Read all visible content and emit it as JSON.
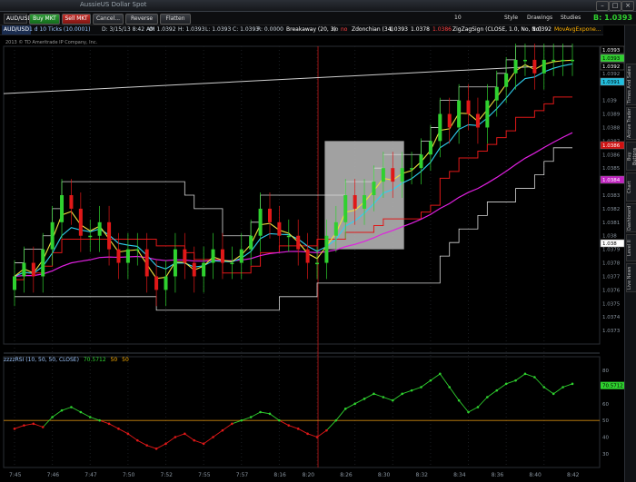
{
  "titlebar": {
    "title": "AussieUS Dollar Spot"
  },
  "toolbar": {
    "symbol": "AUD/USD",
    "buy_label": "Buy MKT",
    "sell_label": "Sell MKT",
    "cancel_label": "Cancel...",
    "reverse_label": "Reverse",
    "flatten_label": "Flatten",
    "zoom_value": "10",
    "style_label": "Style",
    "drawings_label": "Drawings",
    "studies_label": "Studies",
    "bid_label": "B: 1.0393"
  },
  "header": {
    "symbol": "AUD/USD",
    "interval": "1 d 10 Ticks (10.0001)",
    "date": "D: 3/15/13 8:42 AM",
    "open": "O: 1.0392",
    "high": "H: 1.0393",
    "low": "L: 1.0393",
    "close": "C: 1.0393",
    "range": "R: 0.0000",
    "breakaway": "Breakaway (20, 3)",
    "no": "no",
    "no2": "no",
    "donchian": "Zdonchian (34)",
    "d1": "1.0393",
    "d2": "1.0378",
    "d3": "1.0386",
    "zigzag": "ZigZagSign (CLOSE, 1.0, No, No)",
    "zz": "1.0392",
    "mavg": "MovAvgExpone..."
  },
  "copyright": "2013 © TD Ameritrade IP Company, Inc.",
  "price_axis": [
    "1.0393",
    "1.0392",
    "1.039",
    "1.0389",
    "1.0388",
    "1.0387",
    "1.0386",
    "1.0385",
    "1.0384",
    "1.0383",
    "1.0382",
    "1.0381",
    "1.038",
    "1.0379",
    "1.0378",
    "1.0377",
    "1.0376",
    "1.0375",
    "1.0374",
    "1.0373"
  ],
  "price_boxes": [
    {
      "label": "1.0393",
      "color": "#ffffff",
      "bg": "#000000"
    },
    {
      "label": "1.0393",
      "color": "#000000",
      "bg": "#2fd12f"
    },
    {
      "label": "1.0392",
      "color": "#ffffff",
      "bg": "#000000"
    },
    {
      "label": "1.0391",
      "color": "#000000",
      "bg": "#20c0e0"
    },
    {
      "label": "1.0386",
      "color": "#ffffff",
      "bg": "#d01010"
    },
    {
      "label": "1.0384",
      "color": "#ffffff",
      "bg": "#c020c0"
    },
    {
      "label": "1.038",
      "color": "#000000",
      "bg": "#ffffff"
    }
  ],
  "time_axis": [
    "7:45",
    "7:46",
    "7:47",
    "7:50",
    "7:52",
    "7:55",
    "7:57",
    "8:16",
    "8:20",
    "8:26",
    "8:30",
    "8:32",
    "8:34",
    "8:36",
    "8:40",
    "8:42"
  ],
  "rsi": {
    "name": "zzzzRSI (10, 50, 50, CLOSE)",
    "value": "70.5712",
    "ob": "50",
    "os": "50",
    "axis": [
      "80",
      "70",
      "60",
      "50",
      "40",
      "30"
    ],
    "value_box": "70.5712"
  },
  "sidebar_tabs": [
    "Times And Sales",
    "Active Trader",
    "Buy Buttons",
    "Chart",
    "Dashboard",
    "Level II",
    "Live News"
  ],
  "chart_data": {
    "type": "line",
    "price_ylim": [
      1.0372,
      1.0394
    ],
    "x": [
      0,
      1,
      2,
      3,
      4,
      5,
      6,
      7,
      8,
      9,
      10,
      11,
      12,
      13,
      14,
      15,
      16,
      17,
      18,
      19,
      20,
      21,
      22,
      23,
      24,
      25,
      26,
      27,
      28,
      29,
      30,
      31,
      32,
      33,
      34,
      35,
      36,
      37,
      38,
      39,
      40,
      41,
      42,
      43,
      44,
      45,
      46,
      47,
      48,
      49,
      50,
      51,
      52,
      53,
      54,
      55,
      56,
      57,
      58,
      59
    ],
    "series": [
      {
        "name": "close",
        "values": [
          1.0377,
          1.0378,
          1.0377,
          1.0379,
          1.0381,
          1.0383,
          1.0382,
          1.038,
          1.038,
          1.0381,
          1.0379,
          1.0378,
          1.0379,
          1.0379,
          1.0377,
          1.0376,
          1.0377,
          1.0379,
          1.0378,
          1.0377,
          1.0378,
          1.0379,
          1.0378,
          1.0378,
          1.0379,
          1.038,
          1.0382,
          1.0381,
          1.038,
          1.038,
          1.0379,
          1.0378,
          1.0378,
          1.038,
          1.0381,
          1.0383,
          1.0382,
          1.0383,
          1.0384,
          1.0385,
          1.0384,
          1.0385,
          1.0385,
          1.0386,
          1.0387,
          1.0389,
          1.0388,
          1.039,
          1.0389,
          1.0388,
          1.039,
          1.0391,
          1.0392,
          1.0393,
          1.0393,
          1.0392,
          1.0393,
          1.0393,
          1.0393,
          1.0393
        ]
      },
      {
        "name": "rsi",
        "values": [
          45,
          47,
          48,
          46,
          52,
          56,
          58,
          55,
          52,
          50,
          48,
          45,
          42,
          38,
          35,
          33,
          36,
          40,
          42,
          38,
          36,
          40,
          44,
          48,
          50,
          52,
          55,
          54,
          50,
          47,
          45,
          42,
          40,
          44,
          50,
          57,
          60,
          63,
          66,
          64,
          62,
          66,
          68,
          70,
          74,
          78,
          70,
          62,
          55,
          58,
          64,
          68,
          72,
          74,
          78,
          76,
          70,
          66,
          70,
          72
        ]
      }
    ],
    "rsi_ylim": [
      25,
      85
    ],
    "highlight_box": {
      "label": ""
    }
  }
}
